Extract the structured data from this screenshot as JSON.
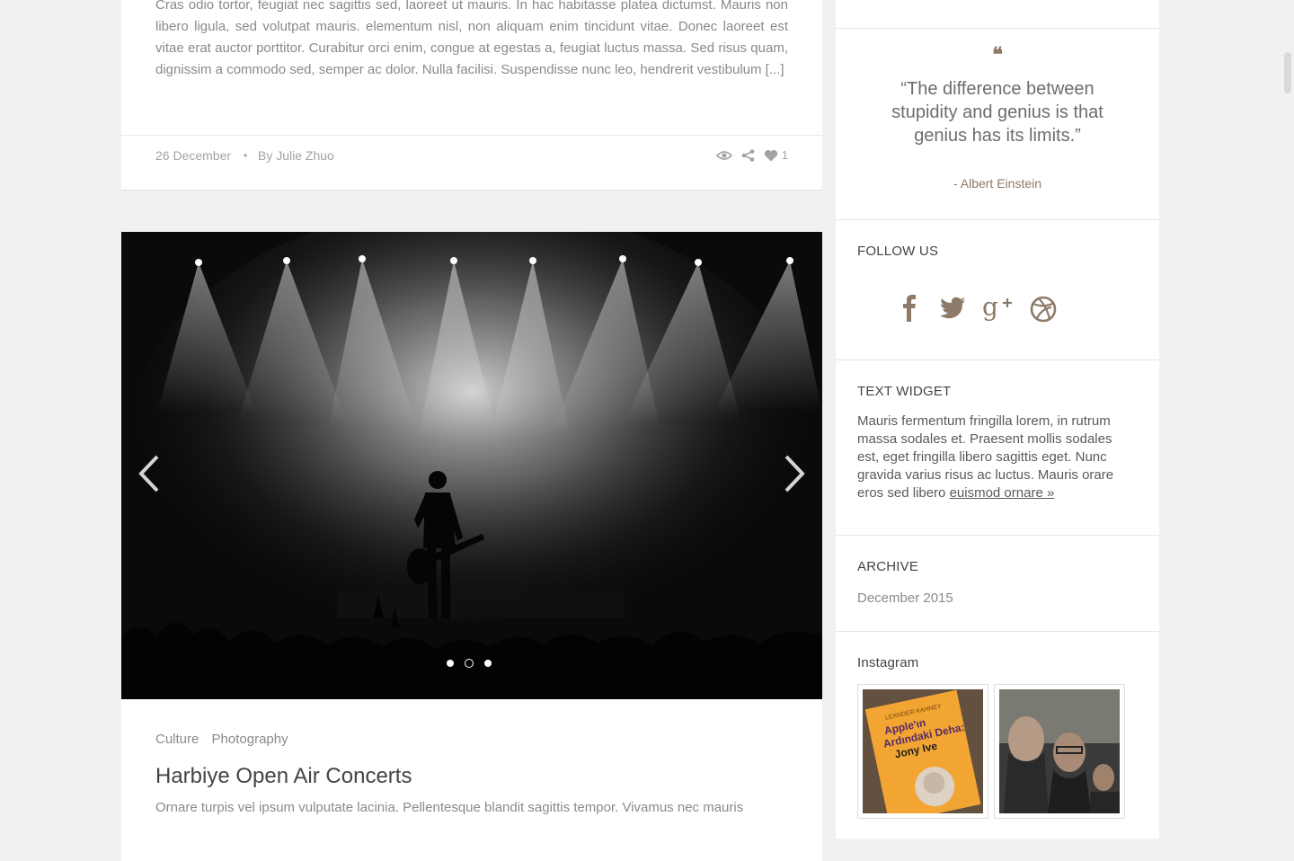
{
  "post1": {
    "excerpt": "Cras odio tortor, feugiat nec sagittis sed, laoreet ut mauris. In hac habitasse platea dictumst. Mauris non libero ligula, sed volutpat mauris. elementum nisl, non aliquam enim tincidunt vitae. Donec laoreet est vitae erat auctor porttitor. Curabitur orci enim, congue at egestas a, feugiat luctus massa. Sed risus quam, dignissim a commodo sed, semper ac dolor. Nulla facilisi. Suspendisse nunc leo, hendrerit vestibulum",
    "read_more": "[...]",
    "date": "26 December",
    "separator": "•",
    "author": "By Julie Zhuo",
    "likes": "1",
    "icons": [
      "eye-icon",
      "share-icon",
      "heart-icon"
    ]
  },
  "post2": {
    "slides_total": 3,
    "active_slide": 2,
    "categories": [
      "Culture",
      "Photography"
    ],
    "title": "Harbiye Open Air Concerts",
    "excerpt": "Ornare turpis vel ipsum vulputate lacinia. Pellentesque blandit sagittis tempor. Vivamus nec mauris"
  },
  "sidebar": {
    "quote": {
      "mark": "❝",
      "text": "“The difference between stupidity and genius is that genius has its limits.”",
      "author": "- Albert Einstein"
    },
    "follow": {
      "title": "FOLLOW US",
      "networks": [
        "facebook-icon",
        "twitter-icon",
        "google-plus-icon",
        "dribbble-icon"
      ]
    },
    "text_widget": {
      "title": "TEXT WIDGET",
      "body": "Mauris fermentum fringilla lorem, in rutrum massa sodales et. Praesent mollis sodales est, eget fringilla libero sagittis eget. Nunc gravida varius risus ac luctus. Mauris orare eros sed libero ",
      "link": "euismod ornare »"
    },
    "archive": {
      "title": "ARCHIVE",
      "items": [
        "December 2015"
      ]
    },
    "instagram": {
      "title": "Instagram",
      "book_cover_text": [
        "LEANDER KAHNEY",
        "Apple'ın",
        "Ardındaki Deha:",
        "Jony Ive"
      ]
    }
  },
  "colors": {
    "accent": "#8d7a68",
    "page_bg": "#f1f1f1",
    "text": "#555555",
    "muted": "#8a8a8a"
  }
}
